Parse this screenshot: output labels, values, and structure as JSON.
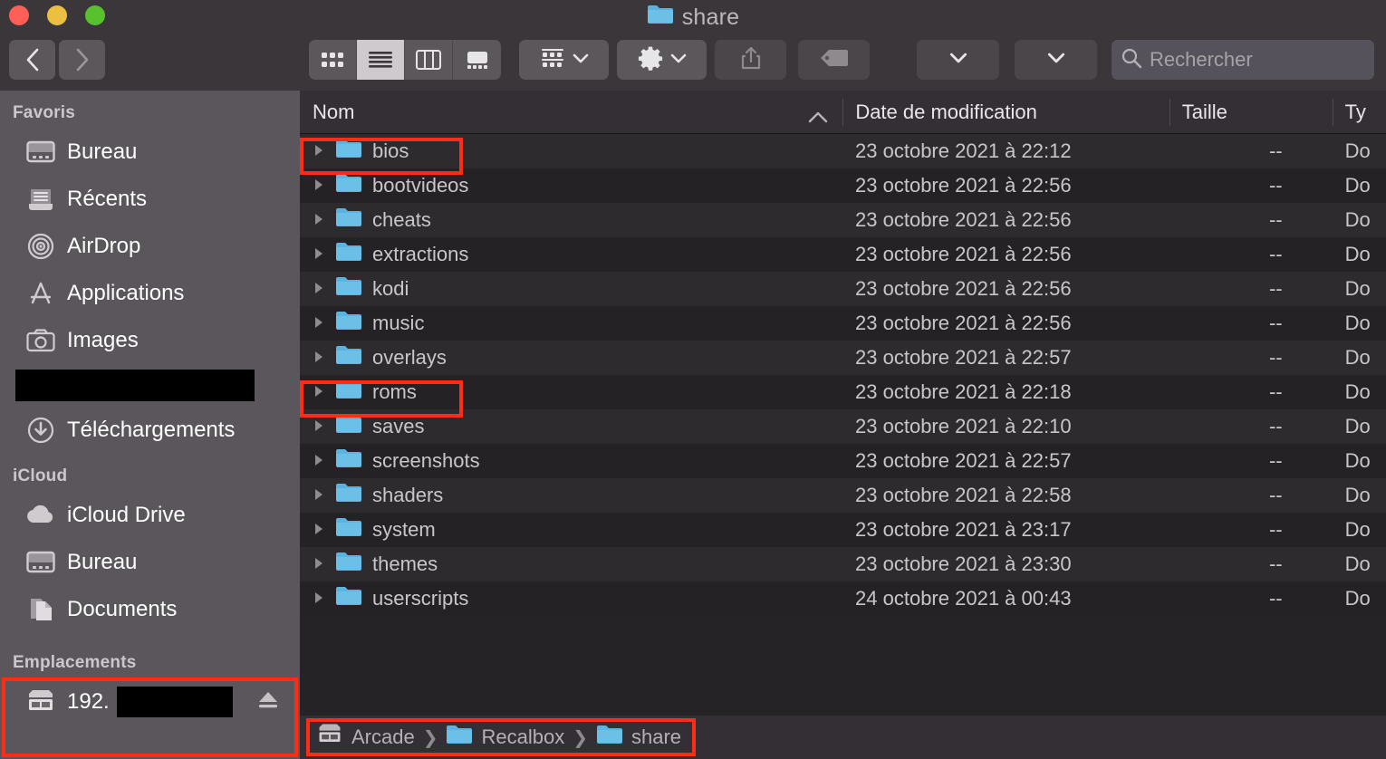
{
  "window": {
    "title": "share",
    "title_icon": "folder-icon",
    "traffic_lights": [
      {
        "name": "close",
        "color": "#ff5f57"
      },
      {
        "name": "minimize",
        "color": "#ebbf40"
      },
      {
        "name": "zoom",
        "color": "#57c22d"
      }
    ]
  },
  "toolbar": {
    "back_label": "Précédent",
    "forward_label": "Suivant",
    "view_modes": [
      {
        "name": "icon-view",
        "active": false
      },
      {
        "name": "list-view",
        "active": true
      },
      {
        "name": "column-view",
        "active": false
      },
      {
        "name": "gallery-view",
        "active": false
      }
    ],
    "group_by_label": "Grouper",
    "action_label": "Action",
    "share_label": "Partager",
    "tags_label": "Tags",
    "dropdown1_label": "",
    "dropdown2_label": "",
    "search": {
      "placeholder": "Rechercher",
      "value": ""
    }
  },
  "sidebar": {
    "sections": [
      {
        "header": "Favoris",
        "items": [
          {
            "label": "Bureau",
            "icon": "desktop-icon"
          },
          {
            "label": "Récents",
            "icon": "recents-icon"
          },
          {
            "label": "AirDrop",
            "icon": "airdrop-icon"
          },
          {
            "label": "Applications",
            "icon": "applications-icon"
          },
          {
            "label": "Images",
            "icon": "photos-icon"
          },
          {
            "label": "",
            "icon": "redacted",
            "redacted": true
          },
          {
            "label": "Téléchargements",
            "icon": "downloads-icon"
          }
        ]
      },
      {
        "header": "iCloud",
        "items": [
          {
            "label": "iCloud Drive",
            "icon": "cloud-icon"
          },
          {
            "label": "Bureau",
            "icon": "desktop-icon"
          },
          {
            "label": "Documents",
            "icon": "documents-icon"
          }
        ]
      },
      {
        "header": "Emplacements",
        "items": [
          {
            "label": "192.",
            "icon": "server-icon",
            "redacted_suffix": true,
            "eject": true
          }
        ]
      }
    ]
  },
  "file_list": {
    "columns": [
      {
        "label": "Nom",
        "sorted": true,
        "sort_direction": "ascending"
      },
      {
        "label": "Date de modification",
        "sorted": false
      },
      {
        "label": "Taille",
        "sorted": false
      },
      {
        "label": "Ty",
        "sorted": false
      }
    ],
    "rows": [
      {
        "name": "bios",
        "date": "23 octobre 2021 à 22:12",
        "size": "--",
        "type": "Do",
        "highlighted": true
      },
      {
        "name": "bootvideos",
        "date": "23 octobre 2021 à 22:56",
        "size": "--",
        "type": "Do",
        "highlighted": false
      },
      {
        "name": "cheats",
        "date": "23 octobre 2021 à 22:56",
        "size": "--",
        "type": "Do",
        "highlighted": false
      },
      {
        "name": "extractions",
        "date": "23 octobre 2021 à 22:56",
        "size": "--",
        "type": "Do",
        "highlighted": false
      },
      {
        "name": "kodi",
        "date": "23 octobre 2021 à 22:56",
        "size": "--",
        "type": "Do",
        "highlighted": false
      },
      {
        "name": "music",
        "date": "23 octobre 2021 à 22:56",
        "size": "--",
        "type": "Do",
        "highlighted": false
      },
      {
        "name": "overlays",
        "date": "23 octobre 2021 à 22:57",
        "size": "--",
        "type": "Do",
        "highlighted": false
      },
      {
        "name": "roms",
        "date": "23 octobre 2021 à 22:18",
        "size": "--",
        "type": "Do",
        "highlighted": true
      },
      {
        "name": "saves",
        "date": "23 octobre 2021 à 22:10",
        "size": "--",
        "type": "Do",
        "highlighted": false
      },
      {
        "name": "screenshots",
        "date": "23 octobre 2021 à 22:57",
        "size": "--",
        "type": "Do",
        "highlighted": false
      },
      {
        "name": "shaders",
        "date": "23 octobre 2021 à 22:58",
        "size": "--",
        "type": "Do",
        "highlighted": false
      },
      {
        "name": "system",
        "date": "23 octobre 2021 à 23:17",
        "size": "--",
        "type": "Do",
        "highlighted": false
      },
      {
        "name": "themes",
        "date": "23 octobre 2021 à 23:30",
        "size": "--",
        "type": "Do",
        "highlighted": false
      },
      {
        "name": "userscripts",
        "date": "24 octobre 2021 à 00:43",
        "size": "--",
        "type": "Do",
        "highlighted": false
      }
    ]
  },
  "path_bar": {
    "crumbs": [
      {
        "label": "Arcade",
        "icon": "server-icon"
      },
      {
        "label": "Recalbox",
        "icon": "folder-icon"
      },
      {
        "label": "share",
        "icon": "folder-icon"
      }
    ],
    "separator": "❯"
  },
  "annotations": {
    "color": "#ff2d16",
    "boxes": [
      "bios-row",
      "roms-row",
      "emplacements-section",
      "path-bar"
    ]
  }
}
